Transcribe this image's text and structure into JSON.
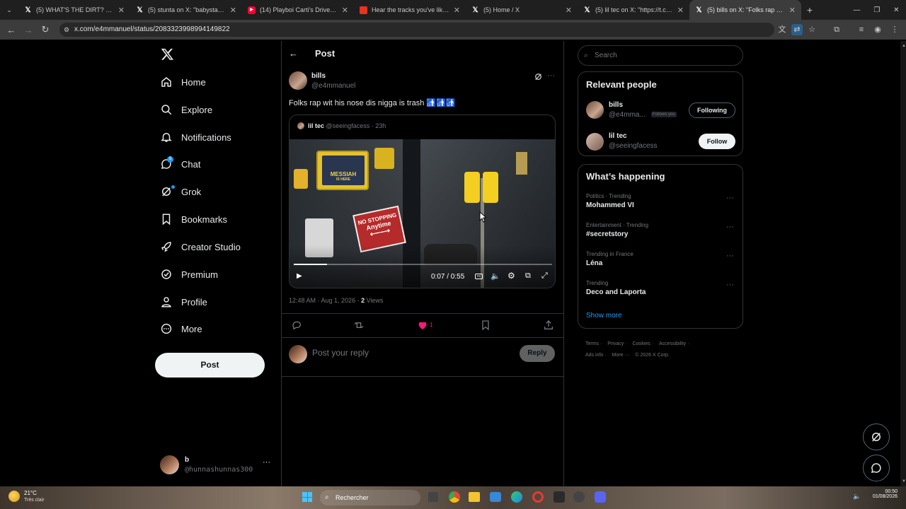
{
  "browser": {
    "tabs": [
      {
        "label": "(5) WHAT'S THE DIRT? on X: \"Th",
        "icon": "x-logo-icon"
      },
      {
        "label": "(5) stunta on X: \"babystaydown",
        "icon": "x-logo-icon"
      },
      {
        "label": "(14) Playboi Carti's Driver Assa",
        "icon": "youtube-icon"
      },
      {
        "label": "Hear the tracks you've liked: on",
        "icon": "youtube-music-icon"
      },
      {
        "label": "(5) Home / X",
        "icon": "x-logo-icon"
      },
      {
        "label": "(5) lil tec on X: \"https://t.co/My",
        "icon": "x-logo-icon"
      },
      {
        "label": "(5) bills on X: \"Folks rap wit his",
        "icon": "x-logo-icon"
      }
    ],
    "url": "x.com/e4mmanuel/status/2083323998994149822"
  },
  "nav": {
    "items": [
      "Home",
      "Explore",
      "Notifications",
      "Chat",
      "Grok",
      "Bookmarks",
      "Creator Studio",
      "Premium",
      "Profile",
      "More"
    ],
    "post_button": "Post",
    "account": {
      "name": "b",
      "handle": "@hunnashunnas300"
    }
  },
  "main": {
    "header": "Post",
    "post": {
      "name": "bills",
      "handle": "@e4mmanuel",
      "text": "Folks rap wit his nose dis nigga is trash 🚮🚮🚮",
      "time": "12:48 AM · Aug 1, 2026 · ",
      "views_count": "2",
      "views_label": " Views",
      "likes": "1"
    },
    "quote": {
      "name": "lil tec",
      "handle": "@seeingfacess",
      "age": "· 23h",
      "video": {
        "time": "0:07 / 0:55",
        "progress": 0.13,
        "sign_top": "MESSIAH",
        "sign_sub": "IS HERE",
        "sign_nostop": "NO STOPPING",
        "sign_anytime": "Anytime"
      }
    },
    "reply": {
      "placeholder": "Post your reply",
      "button": "Reply"
    }
  },
  "sidebar": {
    "search_placeholder": "Search",
    "relevant": {
      "title": "Relevant people",
      "people": [
        {
          "name": "bills",
          "handle": "@e4mma...",
          "badge": "Follows you",
          "button": "Following"
        },
        {
          "name": "lil tec",
          "handle": "@seeingfacess",
          "button": "Follow"
        }
      ]
    },
    "happening": {
      "title": "What’s happening",
      "trends": [
        {
          "category": "Politics · Trending",
          "name": "Mohammed VI"
        },
        {
          "category": "Entertainment · Trending",
          "name": "#secretstory"
        },
        {
          "category": "Trending in France",
          "name": "Léna"
        },
        {
          "category": "Trending",
          "name": "Deco and Laporta"
        }
      ],
      "show_more": "Show more"
    },
    "footer": {
      "row1": [
        "Terms",
        "Privacy",
        "Cookies",
        "Accessibility"
      ],
      "ads": "Ads info",
      "more": "More ···",
      "copyright": "© 2026 X Corp."
    }
  },
  "taskbar": {
    "temp": "21°C",
    "weather": "Très clair",
    "search": "Rechercher",
    "clock_time": "00:50",
    "clock_date": "01/08/2026"
  },
  "colors": {
    "like": "#f91880",
    "accent": "#1d9bf0"
  }
}
